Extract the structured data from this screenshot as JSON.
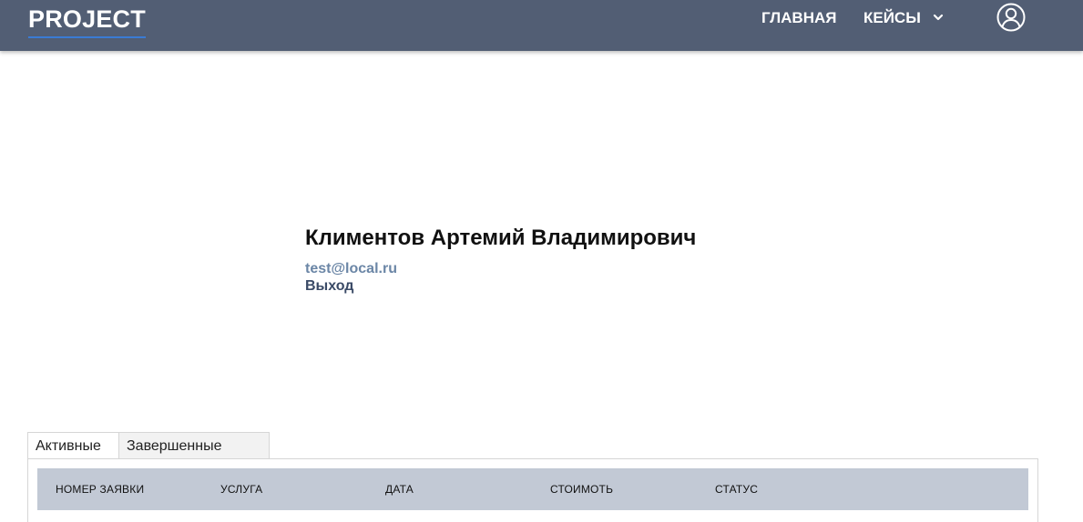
{
  "header": {
    "logo": "PROJECT",
    "nav": {
      "home_label": "ГЛАВНАЯ",
      "cases_label": "КЕЙСЫ"
    },
    "icons": {
      "cases_dropdown": "chevron-down-icon",
      "user": "user-circle-icon"
    },
    "colors": {
      "background": "#525e74",
      "logo_underline": "#3a7bd5"
    }
  },
  "profile": {
    "name": "Климентов Артемий Владимирович",
    "email": "test@local.ru",
    "logout_label": "Выход"
  },
  "tabs": [
    {
      "label": "Активные",
      "active": true
    },
    {
      "label": "Завершенные",
      "active": false
    }
  ],
  "table": {
    "columns": [
      "НОМЕР ЗАЯВКИ",
      "УСЛУГА",
      "ДАТА",
      "СТОИМОТЬ",
      "СТАТУС"
    ],
    "header_color": "#c2c9d5"
  }
}
